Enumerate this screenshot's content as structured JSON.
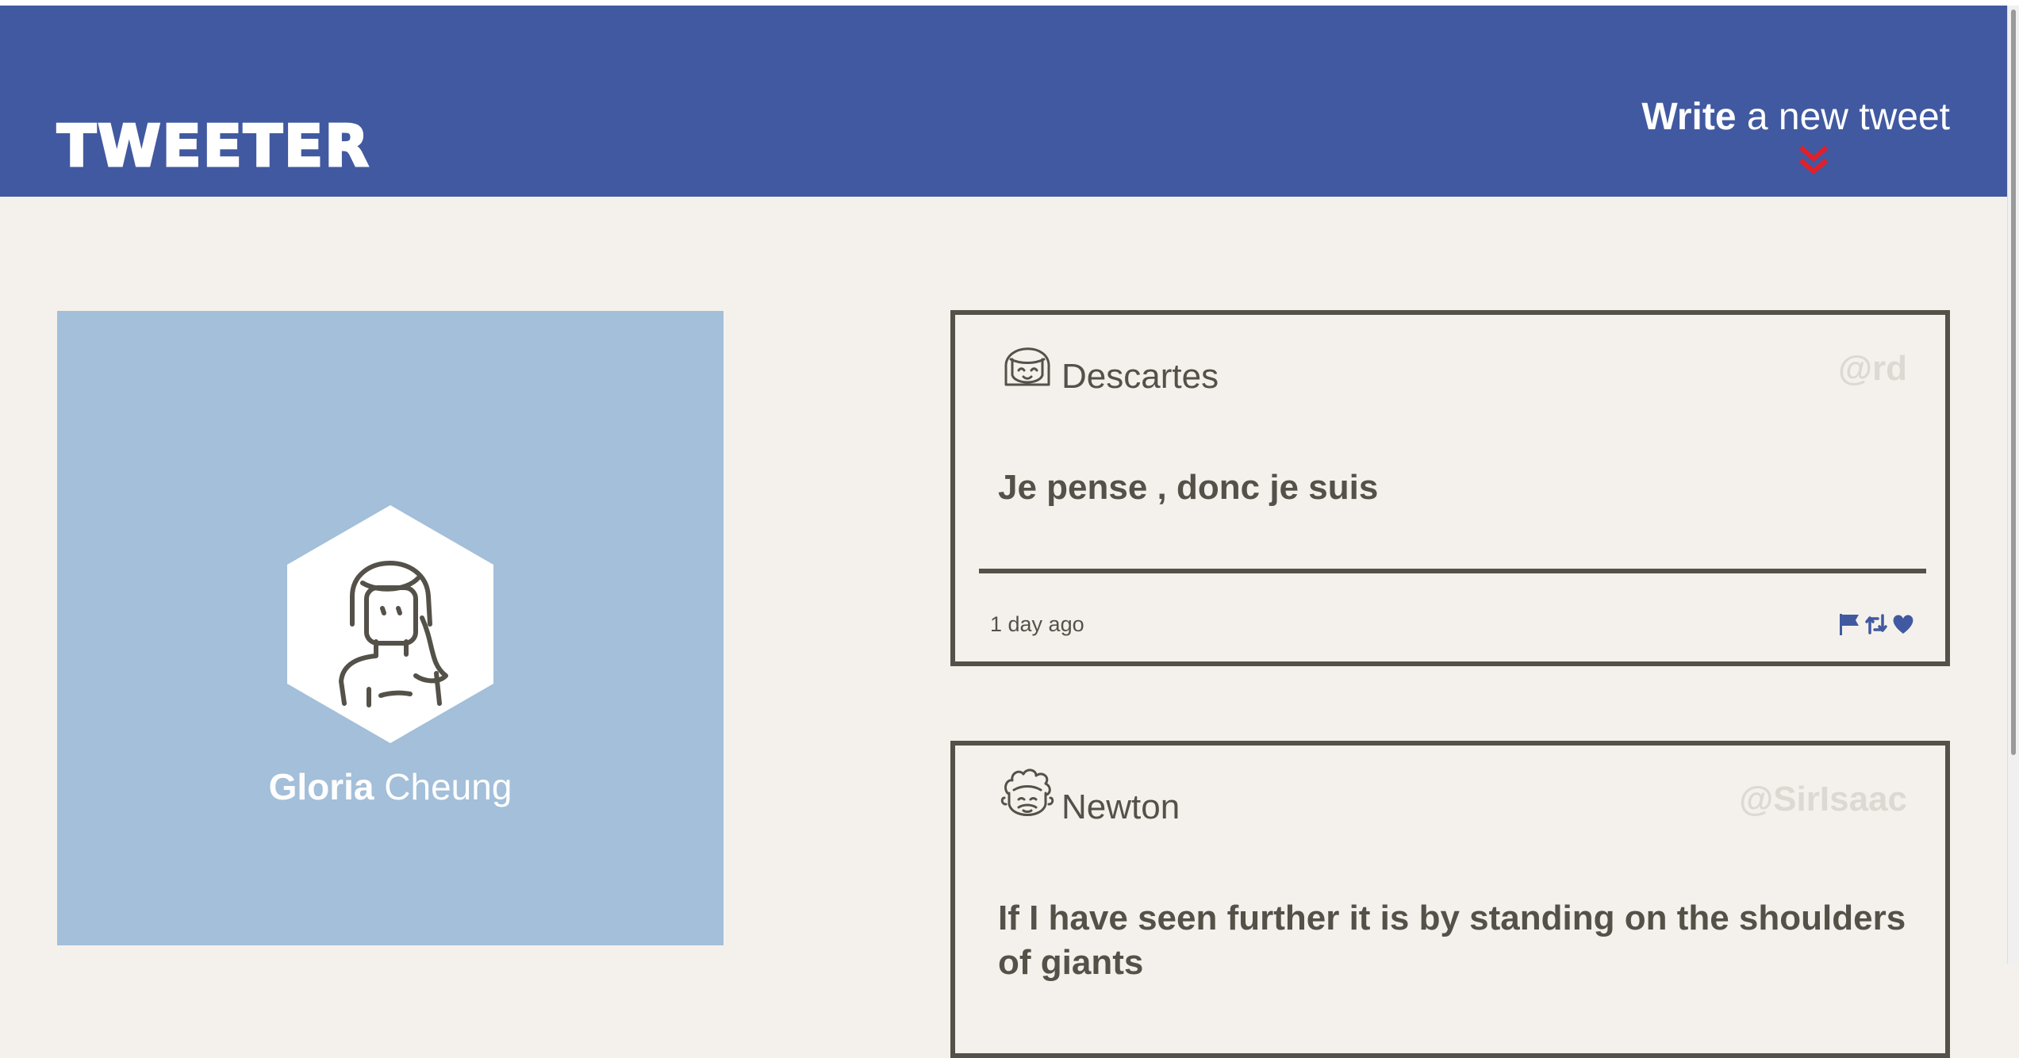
{
  "header": {
    "brand": "TWEETER",
    "compose": {
      "strong": "Write",
      "light": " a new tweet",
      "arrow_icon": "double-chevron-down-icon",
      "arrow_color": "#e0202b"
    },
    "color": "#4159a0"
  },
  "profile": {
    "first_name": "Gloria",
    "last_name": " Cheung",
    "avatar_icon": "woman-avatar-icon",
    "background": "#a3bfd9"
  },
  "tweets": [
    {
      "name": "Descartes",
      "handle": "@rd",
      "content": "Je pense , donc je suis",
      "time": "1 day ago",
      "avatar_icon": "girl-avatar-icon"
    },
    {
      "name": "Newton",
      "handle": "@SirIsaac",
      "content": "If I have seen further it is by standing on the shoulders of giants",
      "avatar_icon": "curly-hair-avatar-icon"
    }
  ],
  "actions": {
    "flag_icon": "flag-icon",
    "retweet_icon": "retweet-icon",
    "like_icon": "heart-icon",
    "color": "#4159a0"
  }
}
